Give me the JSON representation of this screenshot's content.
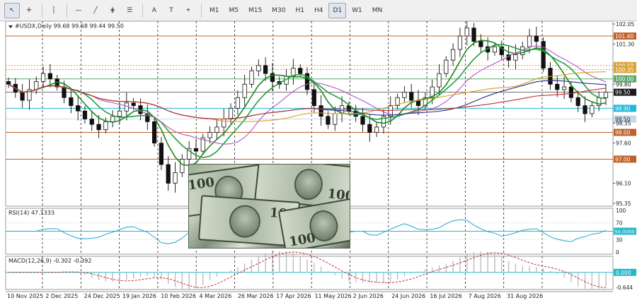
{
  "toolbar": {
    "tools": [
      {
        "name": "cursor-tool",
        "glyph": "↖"
      },
      {
        "name": "crosshair-tool",
        "glyph": "✛"
      },
      {
        "name": "vertical-line-tool",
        "glyph": "│"
      },
      {
        "name": "horizontal-line-tool",
        "glyph": "—"
      },
      {
        "name": "trendline-tool",
        "glyph": "╱"
      },
      {
        "name": "channel-tool",
        "glyph": "⋕"
      },
      {
        "name": "fibonacci-tool",
        "glyph": "☰"
      },
      {
        "name": "text-tool",
        "glyph": "A"
      },
      {
        "name": "text-label-tool",
        "glyph": "T"
      },
      {
        "name": "shapes-tool",
        "glyph": "⌖"
      }
    ],
    "timeframes": [
      "M1",
      "M5",
      "M15",
      "M30",
      "H1",
      "H4",
      "D1",
      "W1",
      "MN"
    ],
    "active_timeframe": "D1"
  },
  "chart_data": [
    {
      "type": "candlestick",
      "header": "#USDX,Daily  99.68 99.68 99.44 99.50",
      "symbol": "#USDX",
      "period": "Daily",
      "ohlc": {
        "open": 99.68,
        "high": 99.68,
        "low": 99.44,
        "close": 99.5
      },
      "ylim": [
        95.35,
        102.05
      ],
      "y_ticks": [
        "102.05",
        "101.30",
        "100.50",
        "99.80",
        "99.50",
        "98.35",
        "97.60",
        "96.10",
        "95.35"
      ],
      "horizontal_levels": [
        {
          "label": "101.60",
          "value": 101.6,
          "color": "#c0602a"
        },
        {
          "label": "100.50",
          "value": 100.5,
          "color": "#d9a43a"
        },
        {
          "label": "100.35",
          "value": 100.35,
          "color": "#d9a43a"
        },
        {
          "label": "100.00",
          "value": 100.0,
          "color": "#5aa86a"
        },
        {
          "label": "99.50",
          "value": 99.5,
          "color": "#1a1a1a"
        },
        {
          "label": "98.90",
          "value": 98.9,
          "color": "#22b8d8"
        },
        {
          "label": "98.50",
          "value": 98.5,
          "color": "#c8d8e8"
        },
        {
          "label": "98.00",
          "value": 98.0,
          "color": "#c0602a"
        },
        {
          "label": "97.00",
          "value": 97.0,
          "color": "#c0602a"
        }
      ],
      "x_labels": [
        "10 Nov 2025",
        "2 Dec 2025",
        "24 Dec 2025",
        "19 Jan 2026",
        "10 Feb 2026",
        "4 Mar 2026",
        "26 Mar 2026",
        "17 Apr 2026",
        "11 May 2026",
        "2 Jun 2026",
        "24 Jun 2026",
        "16 Jul 2026",
        "7 Aug 2026",
        "31 Aug 2026"
      ],
      "close_path": [
        99.8,
        99.5,
        99.2,
        99.6,
        99.9,
        100.2,
        100.0,
        99.7,
        99.3,
        99.0,
        98.8,
        98.5,
        98.3,
        98.1,
        98.4,
        98.6,
        98.8,
        99.1,
        99.0,
        98.7,
        98.4,
        97.6,
        96.8,
        96.1,
        96.5,
        97.0,
        97.4,
        97.3,
        97.8,
        98.0,
        98.2,
        98.5,
        98.9,
        99.3,
        99.8,
        100.3,
        100.5,
        100.2,
        99.9,
        99.8,
        100.1,
        100.4,
        100.2,
        99.6,
        99.0,
        98.6,
        98.3,
        98.7,
        99.0,
        98.8,
        98.6,
        98.3,
        98.0,
        98.2,
        98.6,
        99.0,
        99.3,
        99.5,
        99.2,
        99.0,
        99.3,
        99.7,
        100.2,
        100.7,
        101.1,
        101.6,
        101.9,
        101.4,
        101.2,
        101.0,
        101.2,
        100.9,
        100.7,
        100.9,
        101.2,
        101.6,
        101.4,
        100.4,
        99.8,
        99.6,
        99.7,
        99.3,
        99.0,
        98.7,
        99.0,
        99.3,
        99.5
      ],
      "ma_lines": [
        {
          "role": "green-1",
          "color": "#1a8a1a",
          "period": 5
        },
        {
          "role": "green-2",
          "color": "#1f9f3f",
          "period": 8
        },
        {
          "role": "purple",
          "color": "#b455c8",
          "period": 13
        },
        {
          "role": "orange",
          "color": "#e09a2a",
          "period": 30
        },
        {
          "role": "navy",
          "color": "#2a2e8a",
          "period": 45
        },
        {
          "role": "red",
          "color": "#c0302a",
          "period": 60
        }
      ],
      "grid": "vertical-dashed",
      "legend": "none"
    },
    {
      "type": "line",
      "header": "RSI(14) 47.1333",
      "name": "RSI(14)",
      "last_value": 47.1333,
      "ylim": [
        0,
        100
      ],
      "y_ticks": [
        "100",
        "70",
        "50.0000",
        "30",
        "0"
      ],
      "levels": [
        {
          "label": "50.0000",
          "value": 50
        }
      ],
      "color": "#22a7d0"
    },
    {
      "type": "bar",
      "header": "MACD(12,26,9) -0.302 -0.392",
      "name": "MACD(12,26,9)",
      "main": -0.302,
      "signal": -0.392,
      "ylim": [
        -0.644,
        0.6
      ],
      "y_ticks": [
        "0.000",
        "-0.644"
      ],
      "zero_label": "0.000",
      "bar_color": "#b8b8b8",
      "signal_color": "#c0302a"
    }
  ]
}
